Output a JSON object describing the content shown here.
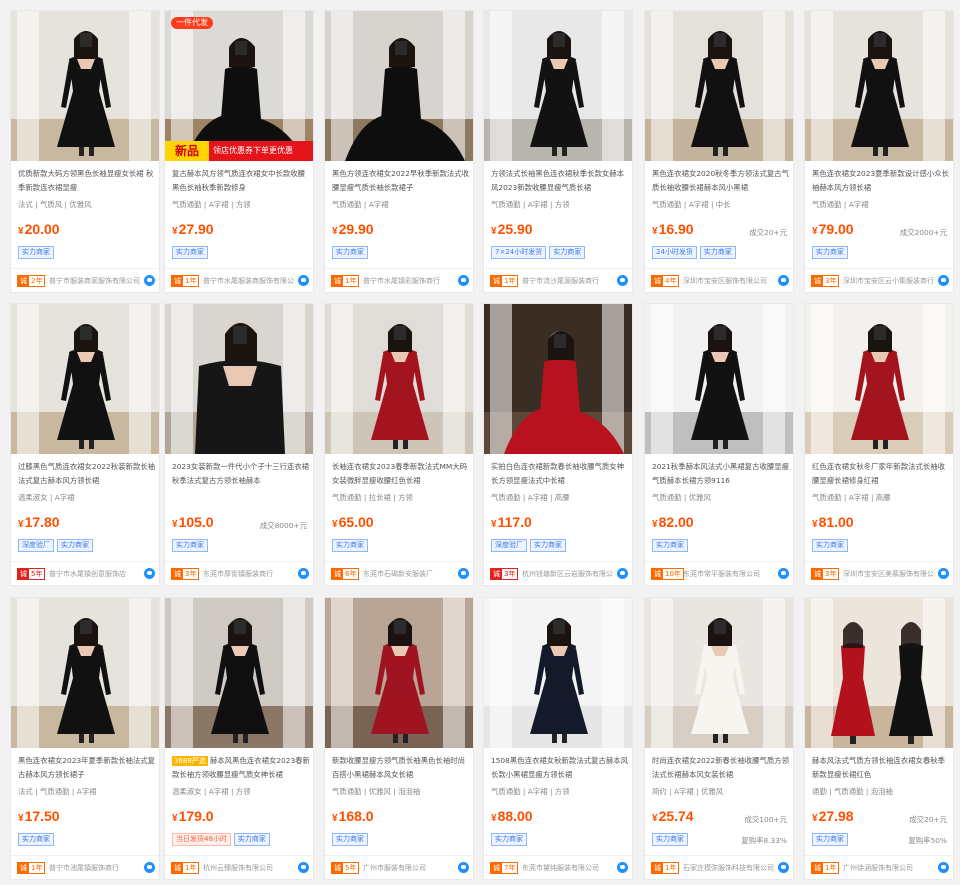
{
  "labels": {
    "yen": "¥",
    "year_prefix": "诚",
    "sold_suffix": "成交",
    "repurchase_label": "复购率"
  },
  "colors": {
    "price": "#ff5000",
    "badge_orange": "#ff6a00",
    "tag_blue": "#3c78e6",
    "promo_red": "#e5141b",
    "promo_yellow": "#ffd400"
  },
  "products": [
    {
      "title": "优质新款大码方领黑色长袖显瘦女长裙 秋季新款连衣裙显瘦",
      "attrs": "法式 | 气质风 | 优雅风",
      "price": "20.00",
      "sold": "",
      "rate": "",
      "tags": [
        "实力商家"
      ],
      "years": "2年",
      "shop": "普宁市服装商家服饰有限公司",
      "dress": "#111111",
      "bg": "#e6e2dc",
      "floor": "#c7b89f",
      "pose": "stand"
    },
    {
      "title": "复古赫本风方领气质连衣裙女中长款收腰黑色长袖秋季新款修身",
      "attrs": "气质通勤 | A字裙 | 方领",
      "price": "27.90",
      "sold": "",
      "rate": "",
      "tags": [
        "实力商家"
      ],
      "years": "1年",
      "badge": "一件代发",
      "promo_new": "新品",
      "promo_text": "领店优惠券下单更优惠",
      "shop": "普宁市水尾服装商服饰有限公司",
      "dress": "#0e0e0e",
      "bg": "#dcdad6",
      "floor": "#9c8465",
      "pose": "sit"
    },
    {
      "title": "黑色方领连衣裙女2022早秋季新款法式收腰显瘦气质长袖长款裙子",
      "attrs": "气质通勤 | A字裙",
      "price": "29.90",
      "sold": "",
      "rate": "",
      "tags": [
        "实力商家"
      ],
      "years": "1年",
      "shop": "普宁市水尾镇彩服饰商行",
      "dress": "#0e0e0e",
      "bg": "#d7d3cf",
      "floor": "#8d7860",
      "pose": "sit"
    },
    {
      "title": "方领法式长袖黑色连衣裙秋季长款女赫本风2023新款收腰显瘦气质长裙",
      "attrs": "气质通勤 | A字裙 | 方领",
      "price": "25.90",
      "sold": "",
      "rate": "",
      "tags": [
        "7×24小时发货",
        "实力商家"
      ],
      "years": "1年",
      "shop": "普宁市流沙尾源服装商行",
      "dress": "#121212",
      "bg": "#e8e8e8",
      "floor": "#b8b4ae",
      "pose": "stand"
    },
    {
      "title": "黑色连衣裙女2020秋冬季方领法式复古气质长袖收腰长裙赫本风小黑裙",
      "attrs": "气质通勤 | A字裙 | 中长",
      "price": "16.90",
      "sold": "成交20+元",
      "rate": "",
      "tags": [
        "24小时发货",
        "实力商家"
      ],
      "years": "4年",
      "shop": "深圳市宝安区服饰有限公司",
      "dress": "#111111",
      "bg": "#e4e0da",
      "floor": "#c2b39a",
      "pose": "stand"
    },
    {
      "title": "黑色连衣裙女2023夏季新款设计感小众长袖赫本风方领长裙",
      "attrs": "气质通勤 | A字裙",
      "price": "79.00",
      "sold": "成交2000+元",
      "rate": "",
      "tags": [
        "实力商家"
      ],
      "years": "3年",
      "shop": "深圳市宝安区云小集服装商行",
      "dress": "#111111",
      "bg": "#e6e2dc",
      "floor": "#c7b89f",
      "pose": "stand"
    },
    {
      "title": "过膝黑色气质连衣裙女2022秋装新款长袖法式复古赫本风方领长裙",
      "attrs": "温柔淑女 | A字裙",
      "price": "17.80",
      "sold": "",
      "rate": "",
      "tags": [
        "深度验厂",
        "实力商家"
      ],
      "years": "5年",
      "year_red": true,
      "shop": "普宁市水尾镇创意服饰店",
      "dress": "#111111",
      "bg": "#e6e2dc",
      "floor": "#c7b89f",
      "pose": "stand"
    },
    {
      "title": "2023女装新款一件代小个子十三行连衣裙秋季法式复古方领长袖赫本",
      "attrs": "",
      "price": "105.0",
      "sold": "成交8000+元",
      "rate": "",
      "tags": [
        "实力商家"
      ],
      "years": "3年",
      "shop": "东莞市厚街镇服装商行",
      "dress": "#161616",
      "bg": "#d9d6d2",
      "floor": "#b0a699",
      "pose": "close"
    },
    {
      "title": "长袖连衣裙女2023春季新款法式MM大码女装微胖显瘦收腰红色长裙",
      "attrs": "气质通勤 | 拉长裙 | 方领",
      "price": "65.00",
      "sold": "",
      "rate": "",
      "tags": [
        "实力商家"
      ],
      "years": "8年",
      "shop": "东莞市石碣新安服装厂",
      "dress": "#a3141f",
      "bg": "#e0ddd8",
      "floor": "#cdc5b8",
      "pose": "stand"
    },
    {
      "title": "实拍白色连衣裙新款春长袖收腰气质女神长方领显瘦法式中长裙",
      "attrs": "气质通勤 | A字裙 | 高腰",
      "price": "117.0",
      "sold": "",
      "rate": "",
      "tags": [
        "深度验厂",
        "实力商家"
      ],
      "years": "3年",
      "year_red": true,
      "shop": "杭州钱塘新区云岩服饰有限公司",
      "dress": "#b8121e",
      "bg": "#3a2d24",
      "floor": "#5b4838",
      "pose": "sit"
    },
    {
      "title": "2021秋季赫本风法式小黑裙复古收腰显瘦气质赫本长裙方领9116",
      "attrs": "气质通勤 | 优雅风",
      "price": "82.00",
      "sold": "",
      "rate": "",
      "tags": [
        "实力商家"
      ],
      "years": "10年",
      "shop": "东莞市常平服装有限公司",
      "dress": "#121212",
      "bg": "#f2f2f2",
      "floor": "#bfbfbf",
      "pose": "stand"
    },
    {
      "title": "红色连衣裙女秋冬厂家年新款法式长袖收腰显瘦长裙修身红裙",
      "attrs": "气质通勤 | A字裙 | 高腰",
      "price": "81.00",
      "sold": "",
      "rate": "",
      "tags": [
        "实力商家"
      ],
      "years": "3年",
      "shop": "深圳市宝安区美慕服饰有限公司",
      "dress": "#a3141f",
      "bg": "#f3f1ee",
      "floor": "#d9ccb8",
      "pose": "stand"
    },
    {
      "title": "黑色连衣裙女2023年夏季新款长袖法式复古赫本风方领长裙子",
      "attrs": "法式 | 气质通勤 | A字裙",
      "price": "17.50",
      "sold": "",
      "rate": "",
      "tags": [
        "实力商家"
      ],
      "years": "1年",
      "shop": "普宁市池尾镇服饰商行",
      "dress": "#111111",
      "bg": "#e6e2dc",
      "floor": "#c7b89f",
      "pose": "stand"
    },
    {
      "title": "赫本风黑色连衣裙女2023春新款长袖方领收腰显瘦气质女神长裙",
      "title_tag": "3688严选",
      "attrs": "温柔淑女 | A字裙 | 方领",
      "price": "179.0",
      "sold": "",
      "rate": "",
      "tags": [
        "当日发货48小时",
        "实力商家"
      ],
      "tags_red_first": true,
      "years": "1年",
      "shop": "杭州云臻服饰有限公司",
      "dress": "#0f0f0f",
      "bg": "#cfcac4",
      "floor": "#8a7766",
      "pose": "stand"
    },
    {
      "title": "新款收腰显瘦方领气质长袖黑色长袖时尚百搭小黑裙赫本风女长裙",
      "attrs": "气质通勤 | 优雅风 | 泡泡袖",
      "price": "168.0",
      "sold": "",
      "rate": "",
      "tags": [
        "实力商家"
      ],
      "years": "5年",
      "shop": "广州市服装有限公司",
      "dress": "#a01422",
      "bg": "#b8a595",
      "floor": "#7a6353",
      "pose": "stand"
    },
    {
      "title": "1508黑色连衣裙女秋新款法式复古赫本风长款小黑裙显瘦方领长裙",
      "attrs": "气质通勤 | A字裙 | 方领",
      "price": "88.00",
      "sold": "",
      "rate": "",
      "tags": [
        "实力商家"
      ],
      "years": "7年",
      "shop": "东莞市黛纯服装有限公司",
      "dress": "#141a2a",
      "bg": "#f4f4f4",
      "floor": "#e6e6e6",
      "pose": "stand"
    },
    {
      "title": "时尚连衣裙女2022新春长袖收腰气质方领法式长裙赫本风女装长裙",
      "attrs": "简约 | A字裙 | 优雅风",
      "price": "25.74",
      "sold": "成交100+元",
      "rate": "8.33%",
      "tags": [
        "实力商家"
      ],
      "years": "1年",
      "shop": "石家庄模弥服饰科技有限公司",
      "dress": "#f7f5f0",
      "bg": "#e9e5e0",
      "floor": "#d8cfc4",
      "pose": "stand"
    },
    {
      "title": "赫本风法式气质方领长袖连衣裙女春秋季新款显瘦长裙红色",
      "attrs": "通勤 | 气质通勤 | 泡泡袖",
      "price": "27.98",
      "sold": "成交20+元",
      "rate": "50%",
      "tags": [
        "实力商家"
      ],
      "years": "1年",
      "shop": "广州徐涵服饰有限公司",
      "dress": "#b3121d",
      "bg": "#ece5dc",
      "floor": "#c9b49c",
      "pose": "pair"
    }
  ]
}
